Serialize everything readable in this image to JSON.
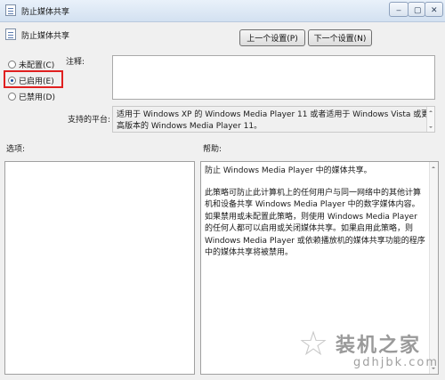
{
  "window": {
    "title": "防止媒体共享",
    "controls": {
      "minimize": "–",
      "maximize": "▢",
      "close": "✕"
    }
  },
  "header": {
    "policy_name": "防止媒体共享",
    "prev_button": "上一个设置(P)",
    "next_button": "下一个设置(N)"
  },
  "state": {
    "options": [
      {
        "label": "未配置(C)",
        "checked": false
      },
      {
        "label": "已启用(E)",
        "checked": true
      },
      {
        "label": "已禁用(D)",
        "checked": false
      }
    ]
  },
  "comment": {
    "label": "注释:",
    "value": ""
  },
  "platform": {
    "label": "支持的平台:",
    "text": "适用于 Windows XP 的 Windows Media Player 11 或者适用于 Windows Vista 或更高版本的 Windows Media Player 11。"
  },
  "options_label": "选项:",
  "help": {
    "label": "帮助:",
    "paragraphs": [
      "防止 Windows Media Player 中的媒体共享。",
      "此策略可防止此计算机上的任何用户与同一网络中的其他计算机和设备共享 Windows Media Player 中的数字媒体内容。如果禁用或未配置此策略，则使用 Windows Media Player 的任何人都可以启用或关闭媒体共享。如果启用此策略，则 Windows Media Player 或依赖播放机的媒体共享功能的程序中的媒体共享将被禁用。"
    ]
  },
  "watermark": {
    "brand": "装机之家",
    "url": "gdhjbk.com"
  },
  "colors": {
    "highlight_border": "#e02020",
    "title_bar": "#d3e1f1",
    "window_bg": "#f0f0f0"
  }
}
